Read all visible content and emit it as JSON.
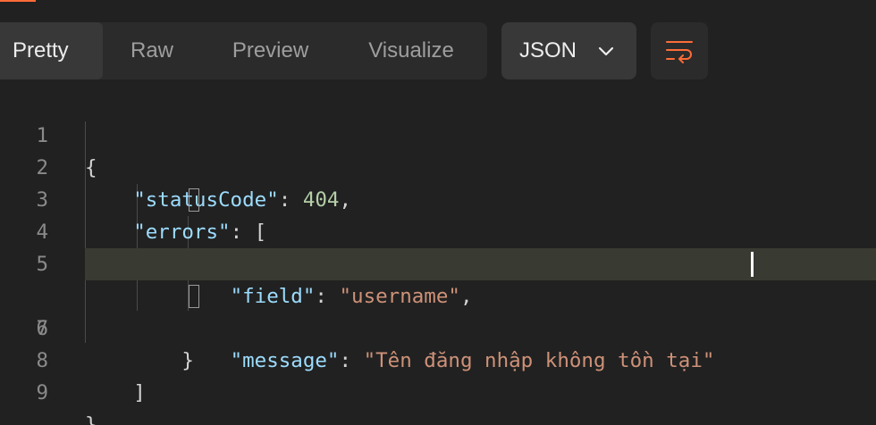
{
  "response_tabs": {
    "items": [
      {
        "label": "Pretty",
        "active": true
      },
      {
        "label": "Raw",
        "active": false
      },
      {
        "label": "Preview",
        "active": false
      },
      {
        "label": "Visualize",
        "active": false
      }
    ]
  },
  "format_select": {
    "value": "JSON",
    "icon": "chevron-down-icon"
  },
  "wrap_button": {
    "icon": "wrap-lines-icon"
  },
  "colors": {
    "accent": "#ff6c37",
    "key": "#9cdcfe",
    "number": "#b5cea8",
    "string": "#ce9178"
  },
  "editor": {
    "lines": [
      {
        "n": "1",
        "tokens": [
          "{"
        ]
      },
      {
        "n": "2",
        "tokens": [
          "    ",
          "\"statusCode\"",
          ": ",
          "404",
          ","
        ]
      },
      {
        "n": "3",
        "tokens": [
          "    ",
          "\"errors\"",
          ": ["
        ]
      },
      {
        "n": "4",
        "tokens": [
          "        ",
          "{"
        ]
      },
      {
        "n": "5",
        "tokens": [
          "            ",
          "\"field\"",
          ": ",
          "\"username\"",
          ","
        ]
      },
      {
        "n": "6",
        "tokens": [
          "            ",
          "\"message\"",
          ": ",
          "\"Tên đăng nhập không tồn tại\""
        ]
      },
      {
        "n": "7",
        "tokens": [
          "        ",
          "}"
        ]
      },
      {
        "n": "8",
        "tokens": [
          "    ",
          "]"
        ]
      },
      {
        "n": "9",
        "tokens": [
          "}"
        ]
      }
    ],
    "highlighted_line": "6"
  }
}
